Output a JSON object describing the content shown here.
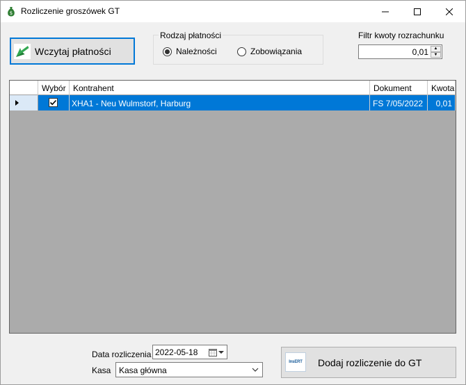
{
  "window": {
    "title": "Rozliczenie groszówek GT",
    "controls": {
      "minimize_icon": "minimize-icon",
      "maximize_icon": "maximize-icon",
      "close_icon": "close-icon"
    }
  },
  "toolbar": {
    "load_button_label": "Wczytaj płatności",
    "load_icon": "green-arrow-icon"
  },
  "payment_type": {
    "title": "Rodzaj płatności",
    "options": [
      {
        "label": "Należności",
        "checked": true
      },
      {
        "label": "Zobowiązania",
        "checked": false
      }
    ]
  },
  "filter": {
    "label": "Filtr kwoty rozrachunku",
    "value": "0,01"
  },
  "grid": {
    "columns": [
      "",
      "Wybór",
      "Kontrahent",
      "Dokument",
      "Kwota"
    ],
    "rows": [
      {
        "selected": true,
        "checked": true,
        "contractor": "XHA1 - Neu Wulmstorf, Harburg",
        "document": "FS 7/05/2022",
        "amount": "0,01"
      }
    ]
  },
  "footer": {
    "date_label": "Data rozliczenia",
    "date_value": "2022-05-18",
    "kasa_label": "Kasa",
    "kasa_value": "Kasa główna",
    "add_button_label": "Dodaj rozliczenie do GT",
    "add_button_logo": "InsERT"
  },
  "colors": {
    "accent": "#0078d7",
    "grid_background": "#ababab",
    "selected_row": "#0078d7"
  }
}
